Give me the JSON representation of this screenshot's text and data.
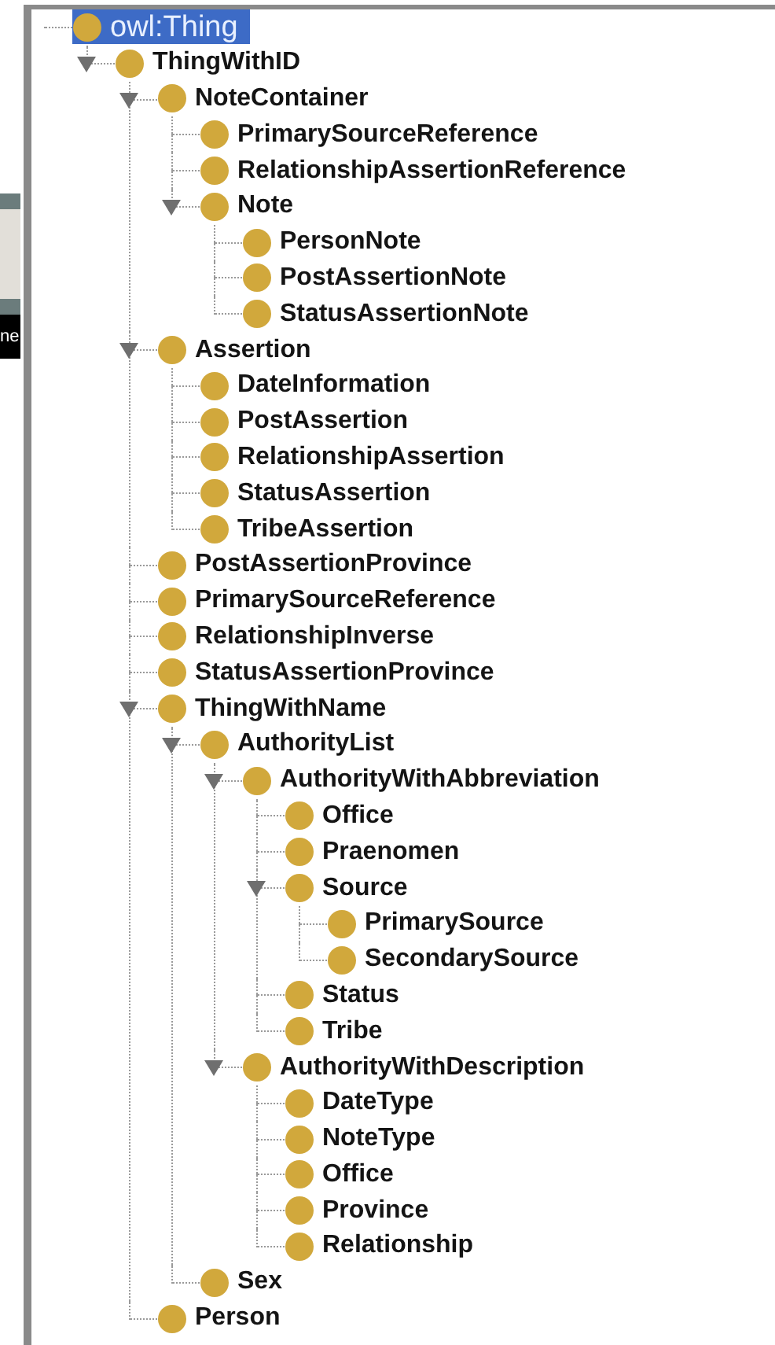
{
  "side_fragment": {
    "text": "ne"
  },
  "tree": [
    {
      "label": "owl:Thing",
      "selected": true,
      "children": [
        {
          "label": "ThingWithID",
          "selected": false,
          "expanded": true,
          "children": [
            {
              "label": "NoteContainer",
              "selected": false,
              "expanded": true,
              "children": [
                {
                  "label": "PrimarySourceReference",
                  "selected": false
                },
                {
                  "label": "RelationshipAssertionReference",
                  "selected": false
                },
                {
                  "label": "Note",
                  "selected": false,
                  "expanded": true,
                  "children": [
                    {
                      "label": "PersonNote",
                      "selected": false
                    },
                    {
                      "label": "PostAssertionNote",
                      "selected": false
                    },
                    {
                      "label": "StatusAssertionNote",
                      "selected": false
                    }
                  ]
                }
              ]
            },
            {
              "label": "Assertion",
              "selected": false,
              "expanded": true,
              "children": [
                {
                  "label": "DateInformation",
                  "selected": false
                },
                {
                  "label": "PostAssertion",
                  "selected": false
                },
                {
                  "label": "RelationshipAssertion",
                  "selected": false
                },
                {
                  "label": "StatusAssertion",
                  "selected": false
                },
                {
                  "label": "TribeAssertion",
                  "selected": false
                }
              ]
            },
            {
              "label": "PostAssertionProvince",
              "selected": false
            },
            {
              "label": "PrimarySourceReference",
              "selected": false
            },
            {
              "label": "RelationshipInverse",
              "selected": false
            },
            {
              "label": "StatusAssertionProvince",
              "selected": false
            },
            {
              "label": "ThingWithName",
              "selected": false,
              "expanded": true,
              "children": [
                {
                  "label": "AuthorityList",
                  "selected": false,
                  "expanded": true,
                  "children": [
                    {
                      "label": "AuthorityWithAbbreviation",
                      "selected": false,
                      "expanded": true,
                      "children": [
                        {
                          "label": "Office",
                          "selected": false
                        },
                        {
                          "label": "Praenomen",
                          "selected": false
                        },
                        {
                          "label": "Source",
                          "selected": false,
                          "expanded": true,
                          "children": [
                            {
                              "label": "PrimarySource",
                              "selected": false
                            },
                            {
                              "label": "SecondarySource",
                              "selected": false
                            }
                          ]
                        },
                        {
                          "label": "Status",
                          "selected": false
                        },
                        {
                          "label": "Tribe",
                          "selected": false
                        }
                      ]
                    },
                    {
                      "label": "AuthorityWithDescription",
                      "selected": false,
                      "expanded": true,
                      "children": [
                        {
                          "label": "DateType",
                          "selected": false
                        },
                        {
                          "label": "NoteType",
                          "selected": false
                        },
                        {
                          "label": "Office",
                          "selected": false
                        },
                        {
                          "label": "Province",
                          "selected": false
                        },
                        {
                          "label": "Relationship",
                          "selected": false
                        }
                      ]
                    }
                  ]
                },
                {
                  "label": "Sex",
                  "selected": false
                }
              ]
            },
            {
              "label": "Person",
              "selected": false
            }
          ]
        }
      ]
    }
  ]
}
